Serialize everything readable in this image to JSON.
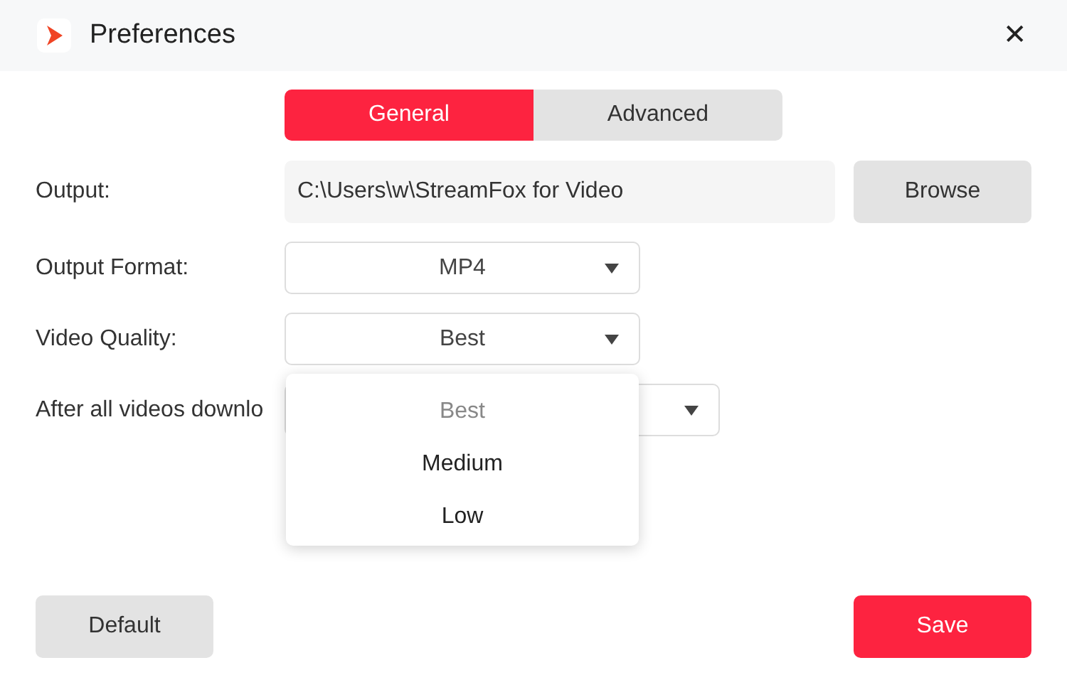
{
  "window": {
    "title": "Preferences",
    "close": "✕"
  },
  "tabs": [
    {
      "label": "General",
      "selected": true
    },
    {
      "label": "Advanced",
      "selected": false
    }
  ],
  "fields": [
    {
      "kind": "path",
      "label": "Output:",
      "value": "C:\\Users\\w\\StreamFox for Video",
      "button": "Browse"
    },
    {
      "kind": "select",
      "label": "Output Format:",
      "value": "MP4"
    },
    {
      "kind": "select",
      "label": "Video Quality:",
      "value": "Best"
    },
    {
      "kind": "select",
      "label": "After all videos downlo"
    }
  ],
  "dropdown": {
    "items": [
      {
        "label": "Best",
        "selected": true
      },
      {
        "label": "Medium",
        "selected": false
      },
      {
        "label": "Low",
        "selected": false
      }
    ]
  },
  "buttons": [
    {
      "label": "Default",
      "kind": "secondary"
    },
    {
      "label": "Save",
      "kind": "primary"
    }
  ]
}
